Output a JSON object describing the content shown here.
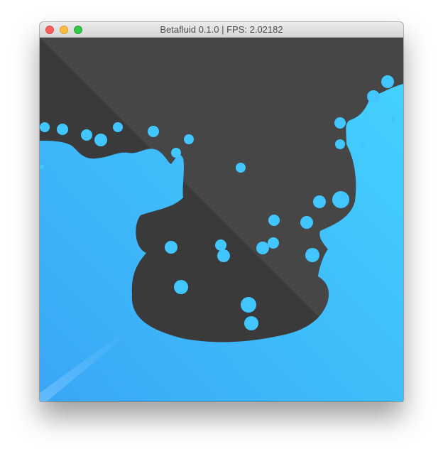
{
  "window": {
    "title": "Betafluid 0.1.0 | FPS: 2.02182"
  },
  "traffic_lights": [
    {
      "name": "close",
      "icon": "close-icon",
      "color": "#fc605c"
    },
    {
      "name": "minimize",
      "icon": "minimize-icon",
      "color": "#fdbc40"
    },
    {
      "name": "maximize",
      "icon": "maximize-icon",
      "color": "#34c84a"
    }
  ],
  "colors": {
    "background_dark": "#3a3a3a",
    "background_light_triangle": "#464646",
    "fluid_light": "#44d3ff",
    "fluid_dark": "#3aa6f6"
  }
}
